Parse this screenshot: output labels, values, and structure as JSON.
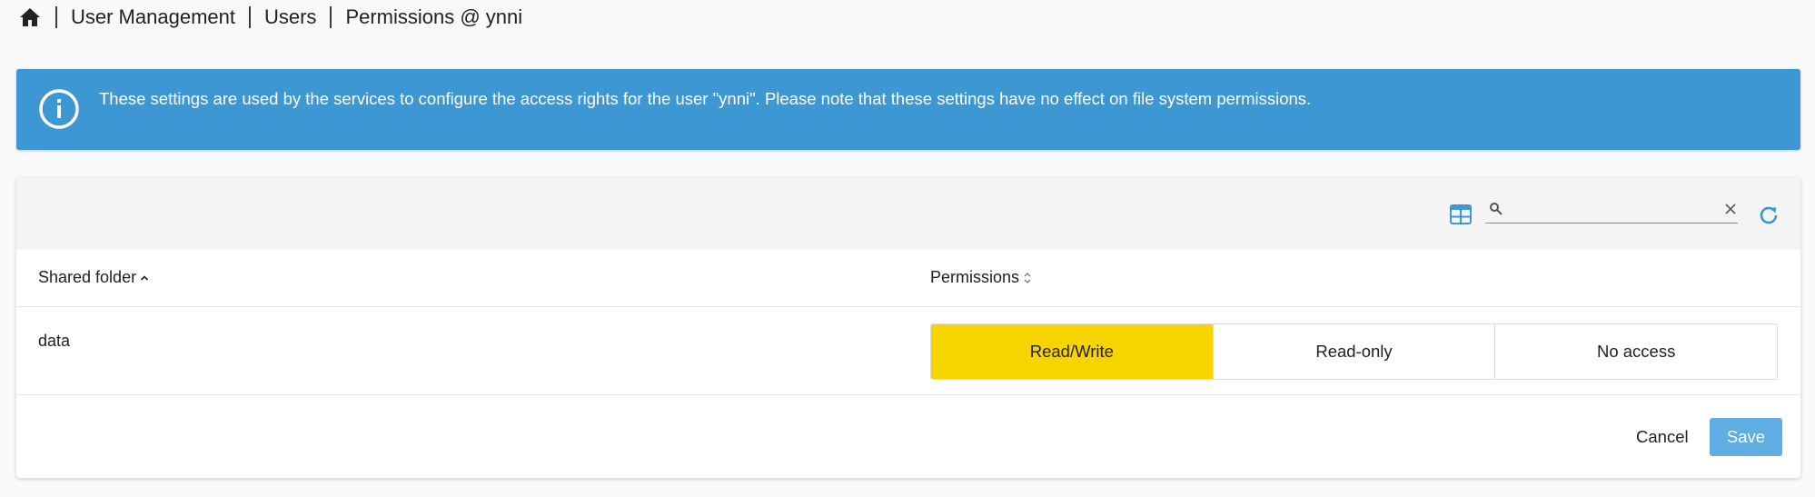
{
  "breadcrumb": {
    "home_icon": "home-icon",
    "items": [
      {
        "label": "User Management"
      },
      {
        "label": "Users"
      },
      {
        "label": "Permissions @ ynni"
      }
    ]
  },
  "alert": {
    "icon": "info-circle-icon",
    "message": "These settings are used by the services to configure the access rights for the user \"ynni\". Please note that these settings have no effect on file system permissions.",
    "color": "#3d97d3"
  },
  "toolbar": {
    "view_icon": "grid-view-icon",
    "search": {
      "value": "",
      "placeholder": "",
      "icon": "search-icon",
      "clear_icon": "close-icon"
    },
    "refresh_icon": "refresh-icon",
    "accent_color": "#3d97d3"
  },
  "table": {
    "columns": [
      {
        "label": "Shared folder",
        "sort": "ascending"
      },
      {
        "label": "Permissions",
        "sort": "none"
      }
    ],
    "rows": [
      {
        "shared_folder": "data",
        "permission_options": [
          "Read/Write",
          "Read-only",
          "No access"
        ],
        "selected": "Read/Write"
      }
    ],
    "selected_color": "#f7d300"
  },
  "footer": {
    "cancel_label": "Cancel",
    "save_label": "Save",
    "save_color": "#5fade3"
  }
}
